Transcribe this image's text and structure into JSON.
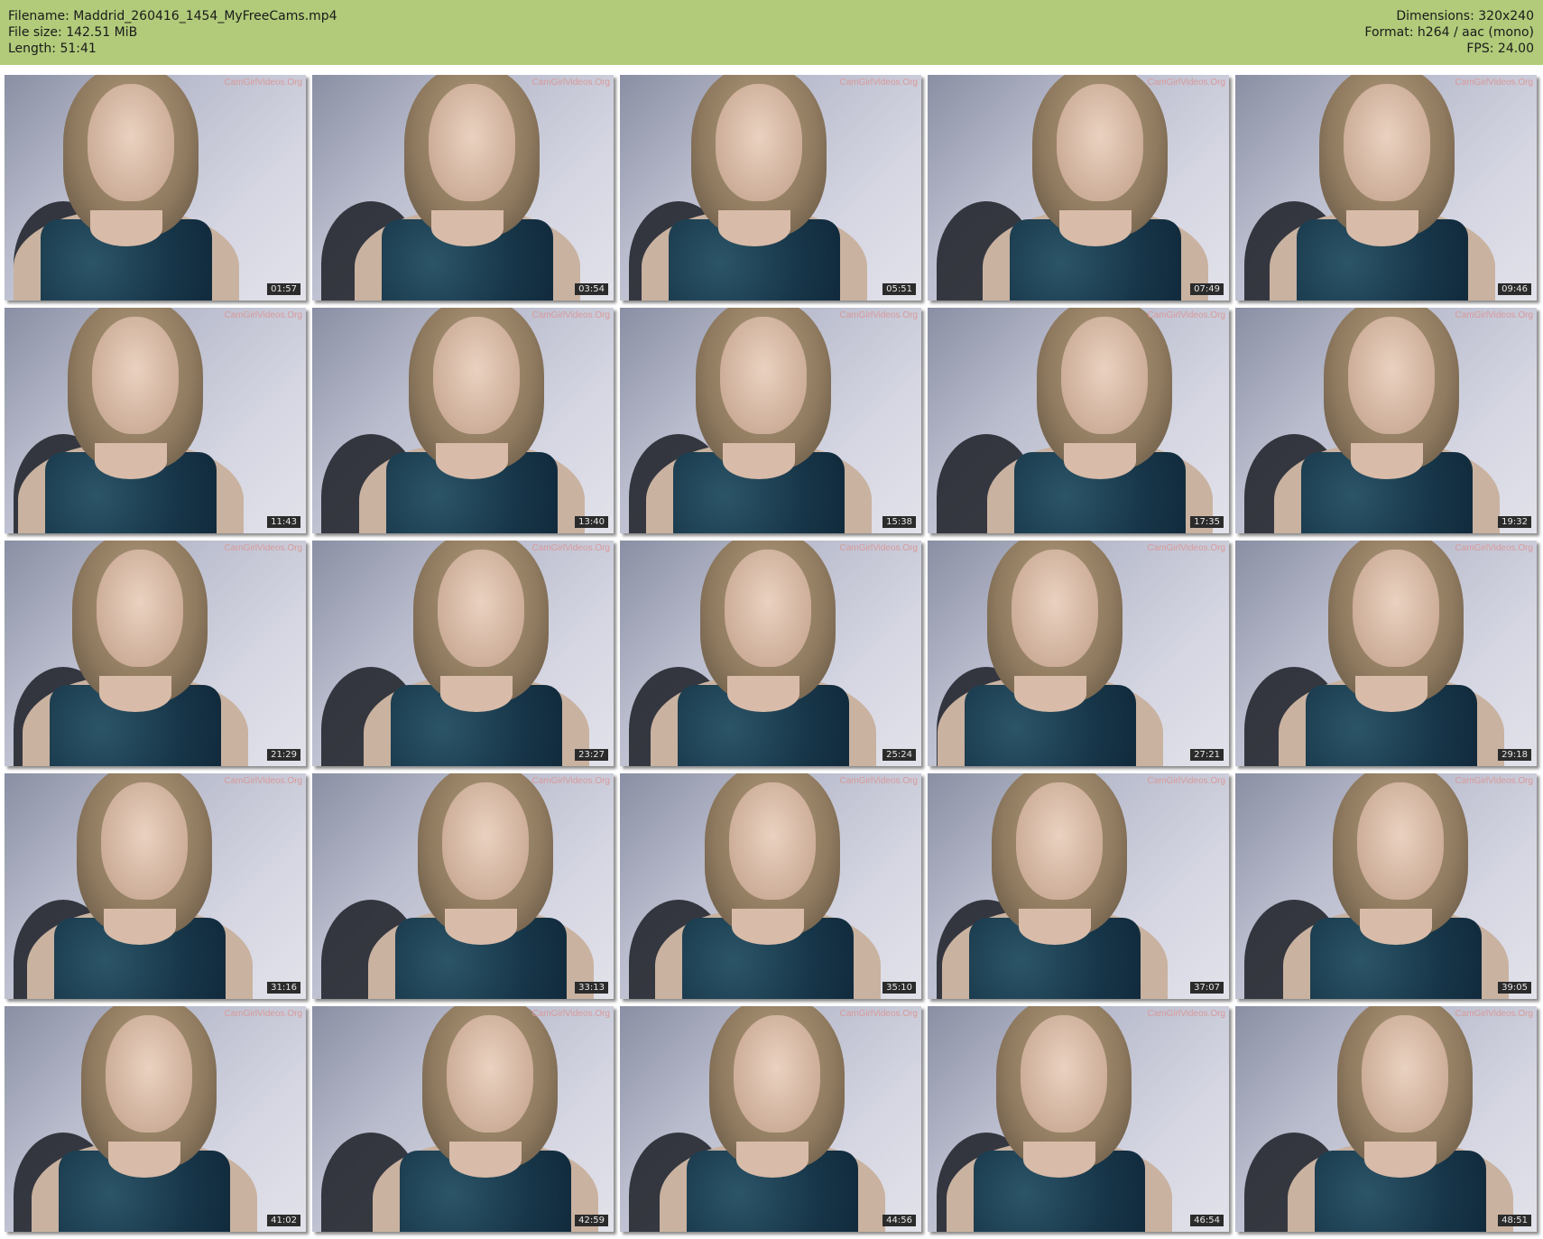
{
  "header": {
    "filename": "Filename: Maddrid_260416_1454_MyFreeCams.mp4",
    "filesize": "File size: 142.51 MiB",
    "length": "Length: 51:41",
    "dimensions": "Dimensions: 320x240",
    "format": "Format: h264 / aac (mono)",
    "fps": "FPS: 24.00",
    "background_color": "#b1cb7a"
  },
  "watermark": "CamGirlVideos.Org",
  "thumbnails": [
    "01:57",
    "03:54",
    "05:51",
    "07:49",
    "09:46",
    "11:43",
    "13:40",
    "15:38",
    "17:35",
    "19:32",
    "21:29",
    "23:27",
    "25:24",
    "27:21",
    "29:18",
    "31:16",
    "33:13",
    "35:10",
    "37:07",
    "39:05",
    "41:02",
    "42:59",
    "44:56",
    "46:54",
    "48:51"
  ]
}
